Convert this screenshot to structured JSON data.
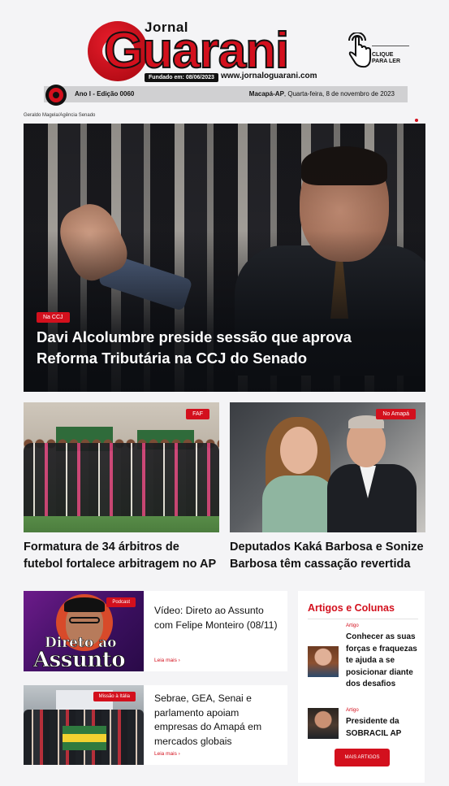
{
  "masthead": {
    "brand_small": "Jornal",
    "brand_large": "Guarani",
    "founded": "Fundado em: 08/06/2023",
    "url": "www.jornaloguarani.com",
    "cta": "CLIQUE PARA LER",
    "cta_line1": "CLIQUE",
    "cta_line2": "PARA LER",
    "edition": "Ano I - Edição 0060",
    "city": "Macapá-AP",
    "date": ", Quarta-feira, 8 de novembro de 2023"
  },
  "hero": {
    "credit": "Geraldo Magela/Agência Senado",
    "tag": "Na CCJ",
    "title": "Davi Alcolumbre preside sessão que aprova Reforma Tributária na CCJ do Senado"
  },
  "stories": [
    {
      "tag": "FAF",
      "title": "Formatura de 34 árbitros de futebol fortalece arbitragem no AP"
    },
    {
      "tag": "No Amapá",
      "title": "Deputados Kaká Barbosa e Sonize Barbosa têm cassação revertida"
    }
  ],
  "cards": [
    {
      "tag": "Podcast",
      "image_text_1": "Direto ao",
      "image_text_2": "Assunto",
      "title": "Vídeo: Direto ao Assunto com Felipe Monteiro (08/11)",
      "more": "Leia mais ›"
    },
    {
      "tag": "Missão à Itália",
      "title": "Sebrae, GEA, Senai e parlamento apoiam empresas do Amapá em mercados globais",
      "more": "Leia mais ›"
    }
  ],
  "sidebar": {
    "title": "Artigos e Colunas",
    "items": [
      {
        "category": "Artigo",
        "headline": "Conhecer as suas forças e fraquezas te ajuda a se posicionar diante dos desafios"
      },
      {
        "category": "Artigo",
        "headline": "Presidente da SOBRACIL AP"
      }
    ],
    "button": "MAIS ARTIGOS"
  },
  "colors": {
    "accent": "#d3101d",
    "bar": "#d0d0d2",
    "background": "#f4f4f6"
  }
}
